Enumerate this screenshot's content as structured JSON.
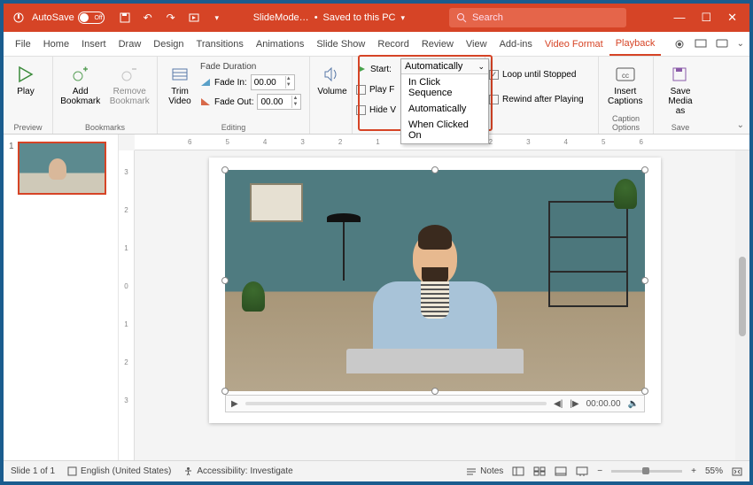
{
  "titlebar": {
    "autosave_label": "AutoSave",
    "autosave_state": "Off",
    "doc_name": "SlideMode…",
    "save_state": "Saved to this PC",
    "search_placeholder": "Search"
  },
  "tabs": {
    "items": [
      "File",
      "Home",
      "Insert",
      "Draw",
      "Design",
      "Transitions",
      "Animations",
      "Slide Show",
      "Record",
      "Review",
      "View",
      "Add-ins"
    ],
    "context": [
      "Video Format",
      "Playback"
    ],
    "active": "Playback"
  },
  "ribbon": {
    "preview": {
      "play": "Play",
      "label": "Preview"
    },
    "bookmarks": {
      "add": "Add\nBookmark",
      "remove": "Remove\nBookmark",
      "label": "Bookmarks"
    },
    "editing": {
      "trim": "Trim\nVideo",
      "fade_title": "Fade Duration",
      "fade_in": "Fade In:",
      "fade_in_val": "00.00",
      "fade_out": "Fade Out:",
      "fade_out_val": "00.00",
      "label": "Editing"
    },
    "volume": "Volume",
    "options": {
      "start_label": "Start:",
      "start_value": "Automatically",
      "start_options": [
        "In Click Sequence",
        "Automatically",
        "When Clicked On"
      ],
      "play_full": "Play F",
      "hide": "Hide V",
      "loop": "Loop until Stopped",
      "rewind": "Rewind after Playing"
    },
    "captions": {
      "insert": "Insert\nCaptions",
      "label": "Caption Options"
    },
    "save": {
      "save_media": "Save\nMedia as",
      "label": "Save"
    }
  },
  "ruler": {
    "h": [
      "6",
      "5",
      "4",
      "3",
      "2",
      "1",
      "0",
      "1",
      "2",
      "3",
      "4",
      "5",
      "6"
    ],
    "v": [
      "3",
      "2",
      "1",
      "0",
      "1",
      "2",
      "3"
    ]
  },
  "thumbs": {
    "num": "1"
  },
  "player": {
    "time": "00:00.00"
  },
  "status": {
    "slide": "Slide 1 of 1",
    "lang": "English (United States)",
    "access": "Accessibility: Investigate",
    "notes": "Notes",
    "zoom": "55%"
  }
}
